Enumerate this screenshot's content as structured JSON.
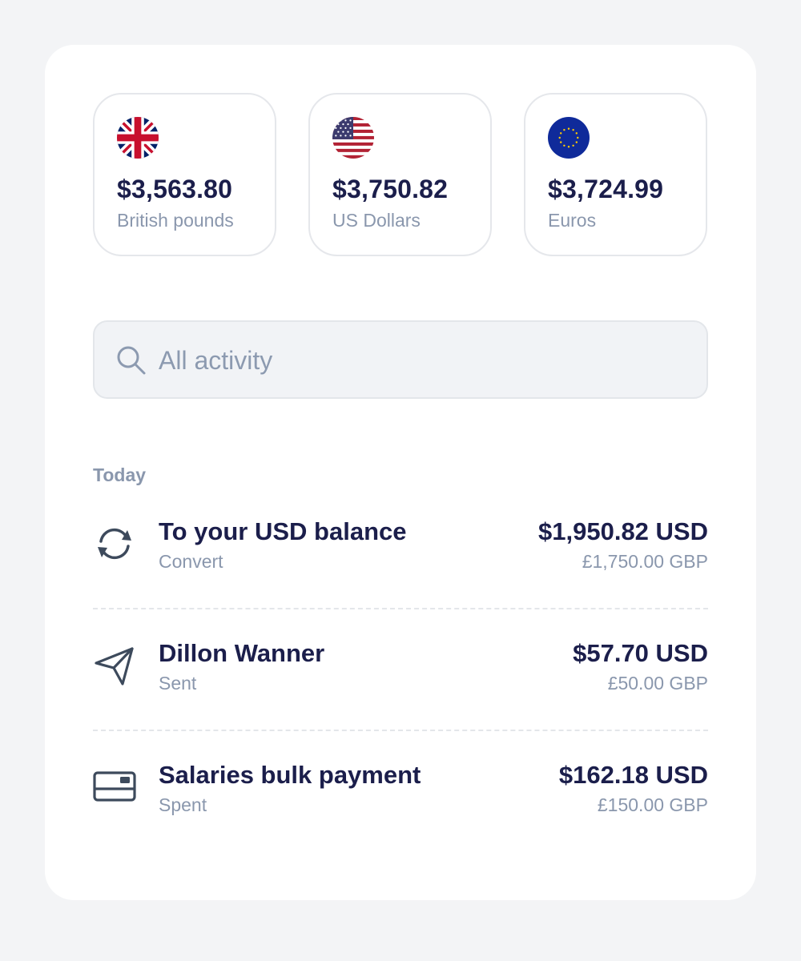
{
  "balances": [
    {
      "amount": "$3,563.80",
      "currency": "British pounds",
      "flag_icon": "uk-flag-icon"
    },
    {
      "amount": "$3,750.82",
      "currency": "US Dollars",
      "flag_icon": "us-flag-icon"
    },
    {
      "amount": "$3,724.99",
      "currency": "Euros",
      "flag_icon": "eu-flag-icon"
    }
  ],
  "search": {
    "placeholder": "All activity",
    "value": "",
    "icon": "search-icon"
  },
  "activity": {
    "section_label": "Today",
    "items": [
      {
        "title": "To your USD balance",
        "subtitle": "Convert",
        "amount": "$1,950.82 USD",
        "sub_amount": "£1,750.00 GBP",
        "icon": "convert-icon"
      },
      {
        "title": "Dillon Wanner",
        "subtitle": "Sent",
        "amount": "$57.70 USD",
        "sub_amount": "£50.00 GBP",
        "icon": "send-icon"
      },
      {
        "title": "Salaries bulk payment",
        "subtitle": "Spent",
        "amount": "$162.18 USD",
        "sub_amount": "£150.00 GBP",
        "icon": "card-icon"
      }
    ]
  },
  "colors": {
    "page_background": "#f3f4f6",
    "card_background": "#ffffff",
    "primary_text": "#1b1e4b",
    "secondary_text": "#8a97ad",
    "icon_color": "#3d4a5c",
    "search_background": "#f1f3f6"
  }
}
